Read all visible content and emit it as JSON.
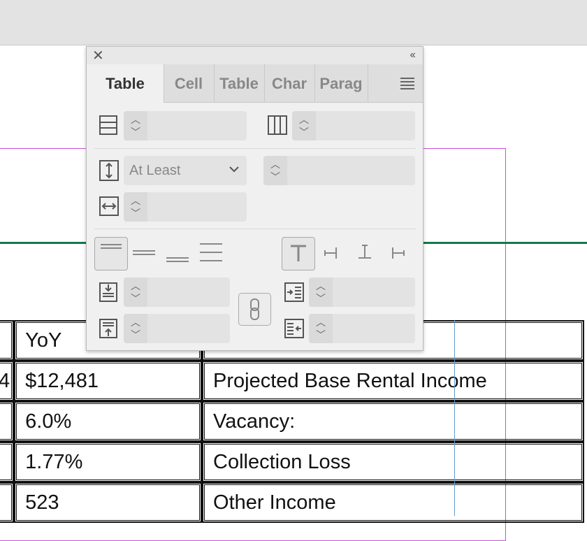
{
  "panel": {
    "tabs": [
      {
        "label": "Table"
      },
      {
        "label": "Cell"
      },
      {
        "label": "Table"
      },
      {
        "label": "Char"
      },
      {
        "label": "Parag"
      }
    ],
    "row_height_mode": "At Least",
    "inputs": {
      "rows": "",
      "columns": "",
      "row_height": "",
      "column_width": "",
      "inset_top": "",
      "inset_bottom": "",
      "inset_left": "",
      "inset_right": ""
    }
  },
  "table": {
    "rows": [
      [
        "",
        "YoY",
        ""
      ],
      [
        "4",
        "$12,481",
        "Projected Base Rental Income"
      ],
      [
        "",
        "6.0%",
        "Vacancy:"
      ],
      [
        "",
        "1.77%",
        "Collection Loss"
      ],
      [
        "",
        "523",
        "Other Income"
      ]
    ]
  }
}
